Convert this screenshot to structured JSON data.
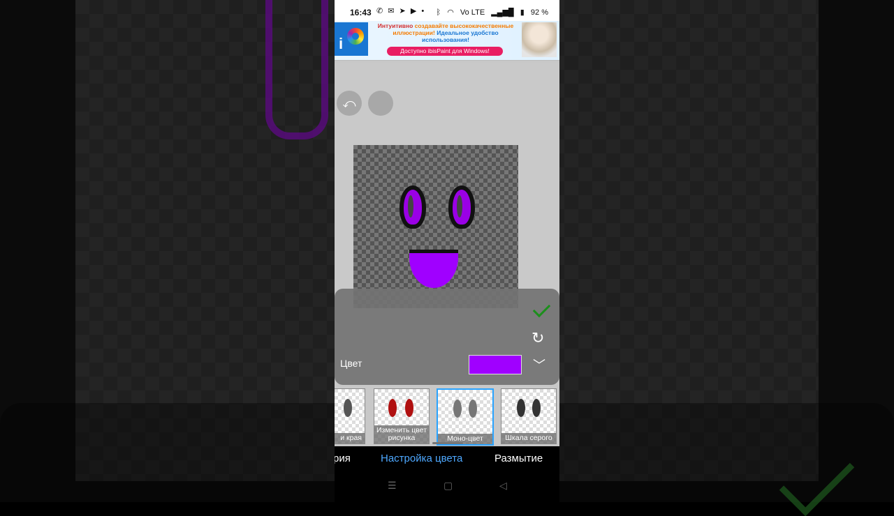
{
  "status": {
    "time": "16:43",
    "left_icons": "✆ ✉ ➤ ▶ •",
    "signal": "Vo LTE",
    "battery": "92 %"
  },
  "ad": {
    "logo_letter": "i",
    "line1_a": "Интуитивно ",
    "line1_b": "создавайте высококачественные",
    "line2_a": "иллюстрации! ",
    "line2_b": "Идеальное удобство",
    "line3": "использования!",
    "button": "Доступно ibisPaint для Windows!"
  },
  "canvas": {
    "undo_icon": "⤺"
  },
  "panel": {
    "color_label": "Цвет",
    "color_value": "#a000ff"
  },
  "filters": [
    {
      "label": "и края"
    },
    {
      "label": "Изменить цвет рисунка"
    },
    {
      "label": "Моно-цвет"
    },
    {
      "label": "Шкала серого"
    }
  ],
  "tabs": [
    {
      "label": "рия"
    },
    {
      "label": "Настройка цвета"
    },
    {
      "label": "Размытие"
    }
  ],
  "nav": {
    "menu": "☰",
    "home": "▢",
    "back": "◁"
  }
}
